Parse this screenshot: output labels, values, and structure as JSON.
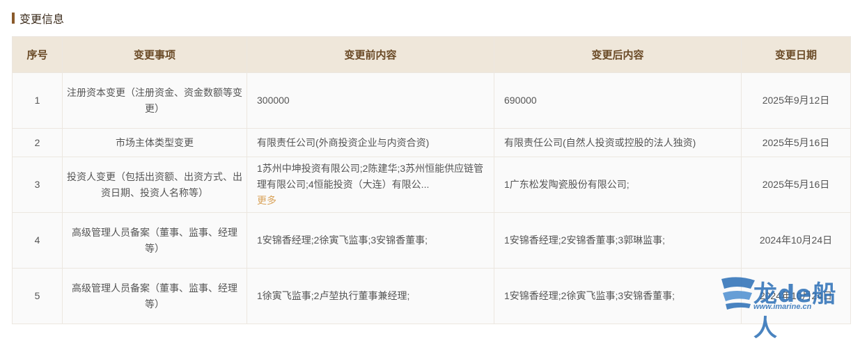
{
  "section": {
    "title": "变更信息"
  },
  "table": {
    "headers": [
      "序号",
      "变更事项",
      "变更前内容",
      "变更后内容",
      "变更日期"
    ],
    "rows": [
      {
        "index": "1",
        "item": "注册资本变更（注册资金、资金数额等变更）",
        "before": "300000",
        "after": "690000",
        "date": "2025年9月12日"
      },
      {
        "index": "2",
        "item": "市场主体类型变更",
        "before": "有限责任公司(外商投资企业与内资合资)",
        "after": "有限责任公司(自然人投资或控股的法人独资)",
        "date": "2025年5月16日"
      },
      {
        "index": "3",
        "item": "投资人变更（包括出资额、出资方式、出资日期、投资人名称等）",
        "before": "1苏州中坤投资有限公司;2陈建华;3苏州恒能供应链管理有限公司;4恒能投资（大连）有限公...",
        "before_more": "更多",
        "after": "1广东松发陶瓷股份有限公司;",
        "date": "2025年5月16日"
      },
      {
        "index": "4",
        "item": "高级管理人员备案（董事、监事、经理等）",
        "before": "1安锦香经理;2徐寅飞监事;3安锦香董事;",
        "after": "1安锦香经理;2安锦香董事;3郭琳监事;",
        "date": "2024年10月24日"
      },
      {
        "index": "5",
        "item": "高级管理人员备案（董事、监事、经理等）",
        "before": "1徐寅飞监事;2卢堃执行董事兼经理;",
        "after": "1安锦香经理;2徐寅飞监事;3安锦香董事;",
        "date": "2024年10月24日"
      }
    ]
  },
  "watermark": {
    "brand": "龙de船人",
    "url": "www.imarine.cn"
  },
  "colors": {
    "accent": "#8a5a2b",
    "header_bg": "#efe7da",
    "header_text": "#6a4a26",
    "link": "#d9a35a"
  }
}
